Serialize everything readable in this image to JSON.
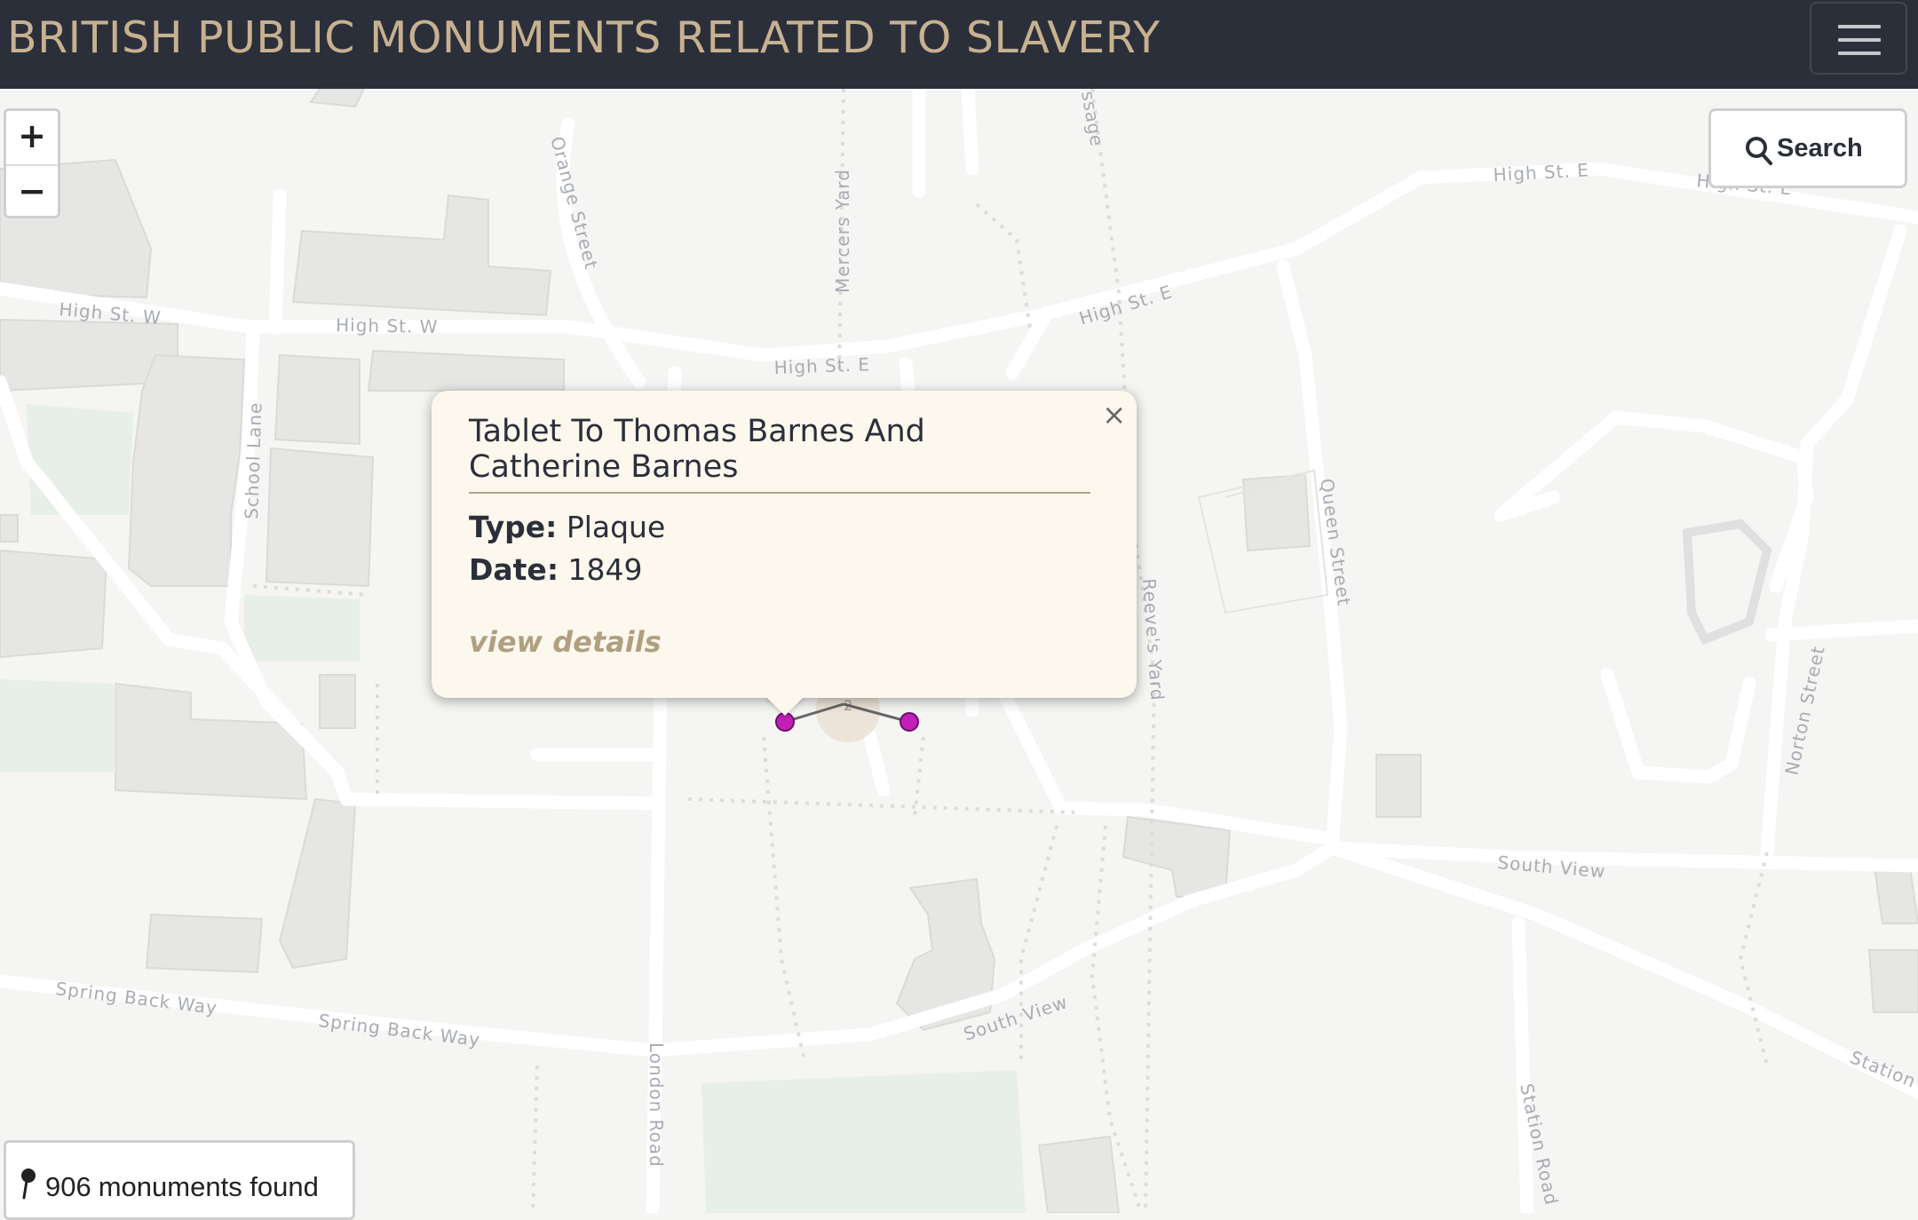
{
  "navbar": {
    "title": "BRITISH PUBLIC MONUMENTS RELATED TO SLAVERY",
    "menu_icon": "hamburger-icon"
  },
  "map": {
    "zoom_in": "+",
    "zoom_out": "−",
    "search_label": "Search",
    "search_icon": "magnifier-icon",
    "streets": {
      "high_st_w_1": "High St. W",
      "high_st_w_2": "High St. W",
      "high_st_e_1": "High St. E",
      "high_st_e_2": "High St. E",
      "high_st_e_3": "High St. E",
      "high_st_e_4": "High St. E",
      "orange_street": "Orange Street",
      "mercers_yard": "Mercers Yard",
      "passage": "ssage",
      "school_lane": "School Lane",
      "reeves_yard": "Reeve's Yard",
      "queen_street": "Queen Street",
      "norton_street": "Norton Street",
      "south_view_1": "South View",
      "south_view_2": "South View",
      "spring_back_way_1": "Spring Back Way",
      "spring_back_way_2": "Spring Back Way",
      "london_road": "London Road",
      "station_road": "Station Road",
      "station": "Station"
    },
    "cluster_count": "2",
    "marker_color": "#c21fb8"
  },
  "popup": {
    "title": "Tablet To Thomas Barnes And Catherine Barnes",
    "type_label": "Type:",
    "type_value": "Plaque",
    "date_label": "Date:",
    "date_value": "1849",
    "link_label": "view details",
    "close_label": "×"
  },
  "counter": {
    "count": "906",
    "label": "monuments found",
    "icon": "map-pin-icon"
  }
}
